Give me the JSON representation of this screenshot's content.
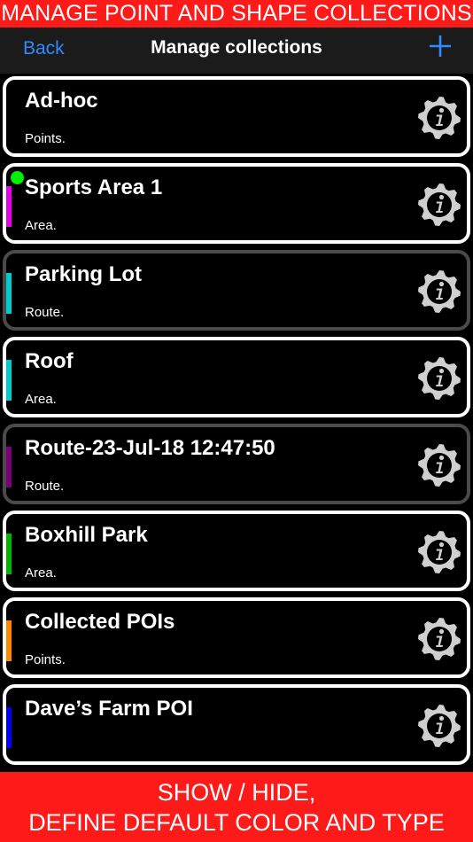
{
  "top_banner": "MANAGE POINT AND SHAPE COLLECTIONS",
  "nav": {
    "back_label": "Back",
    "title": "Manage collections",
    "add_icon": "plus-icon"
  },
  "colors": {
    "banner": "#ff1a1a",
    "accent": "#2f8cff",
    "visible_dot": "#00ee00"
  },
  "collections": [
    {
      "title": "Ad-hoc",
      "type": "Points.",
      "color": "",
      "visible": false,
      "dim": false
    },
    {
      "title": "Sports Area 1",
      "type": "Area.",
      "color": "#e400e4",
      "visible": true,
      "dim": false
    },
    {
      "title": "Parking Lot",
      "type": "Route.",
      "color": "#00cccc",
      "visible": false,
      "dim": true
    },
    {
      "title": "Roof",
      "type": "Area.",
      "color": "#00cccc",
      "visible": false,
      "dim": false
    },
    {
      "title": "Route-23-Jul-18 12:47:50",
      "type": "Route.",
      "color": "#7a007a",
      "visible": false,
      "dim": true
    },
    {
      "title": "Boxhill Park",
      "type": "Area.",
      "color": "#00b400",
      "visible": false,
      "dim": false
    },
    {
      "title": "Collected POIs",
      "type": "Points.",
      "color": "#ff8800",
      "visible": false,
      "dim": false
    },
    {
      "title": "Dave’s Farm POI",
      "type": "",
      "color": "#0000ff",
      "visible": false,
      "dim": false
    }
  ],
  "bottom_banner": {
    "line1": "SHOW / HIDE,",
    "line2": "DEFINE DEFAULT COLOR AND TYPE"
  }
}
